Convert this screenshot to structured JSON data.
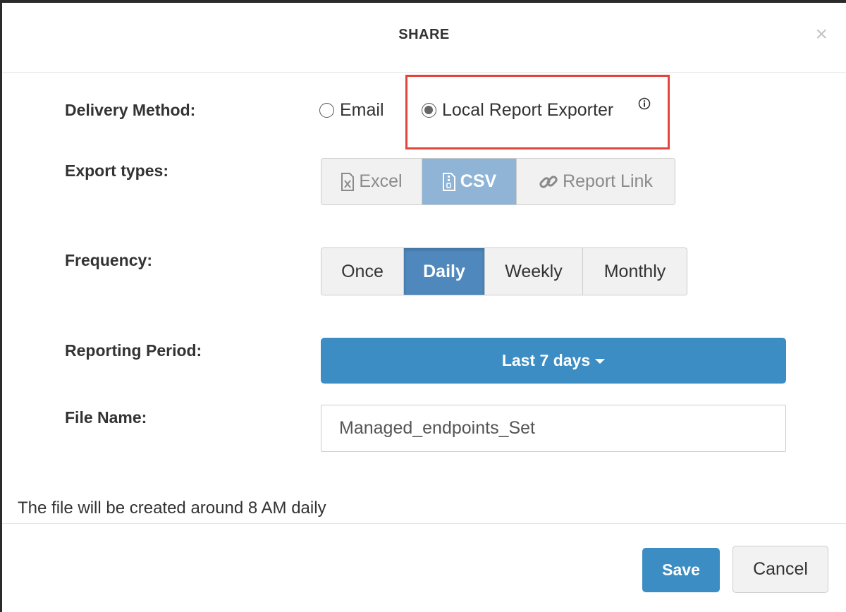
{
  "dialog": {
    "title": "SHARE",
    "close_glyph": "×"
  },
  "delivery": {
    "label": "Delivery Method:",
    "options": [
      {
        "label": "Email",
        "selected": false
      },
      {
        "label": "Local Report Exporter",
        "selected": true
      }
    ],
    "info_icon": "info-icon",
    "highlight_color": "#e2463a"
  },
  "export_types": {
    "label": "Export types:",
    "options": [
      {
        "label": "Excel",
        "icon": "excel-file-icon",
        "active": false
      },
      {
        "label": "CSV",
        "icon": "csv-file-icon",
        "active": true
      },
      {
        "label": "Report Link",
        "icon": "link-icon",
        "active": false
      }
    ]
  },
  "frequency": {
    "label": "Frequency:",
    "options": [
      {
        "label": "Once",
        "active": false
      },
      {
        "label": "Daily",
        "active": true
      },
      {
        "label": "Weekly",
        "active": false
      },
      {
        "label": "Monthly",
        "active": false
      }
    ]
  },
  "reporting_period": {
    "label": "Reporting Period:",
    "value": "Last 7 days"
  },
  "file_name": {
    "label": "File Name:",
    "value": "Managed_endpoints_Set"
  },
  "note": "The file will be created around 8 AM daily",
  "footer": {
    "save_label": "Save",
    "cancel_label": "Cancel"
  },
  "colors": {
    "primary": "#3b8dc4",
    "active_segment": "#4e88bd",
    "active_export": "#8fb4d6"
  }
}
